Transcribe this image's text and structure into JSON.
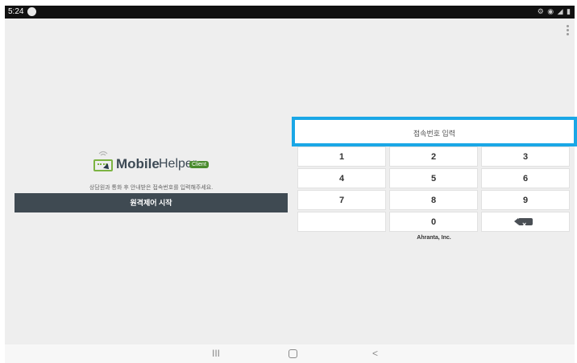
{
  "status_bar": {
    "time": "5:24",
    "icons": "⚙ ◉ ◢ ▮"
  },
  "app": {
    "logo_mobile": "Mobile",
    "logo_helper": "Helper",
    "logo_client_badge": "Client",
    "instruction": "상담원과 통화 후 안내받은 접속번호를 입력해주세요.",
    "start_button": "원격제어 시작",
    "code_input_placeholder": "접속번호 입력",
    "keys": [
      "1",
      "2",
      "3",
      "4",
      "5",
      "6",
      "7",
      "8",
      "9",
      "",
      "0"
    ],
    "company": "Ahranta, Inc."
  },
  "colors": {
    "accent": "#1aa7e6",
    "button_bg": "#3f4a52",
    "logo_green": "#7cb342"
  },
  "icons": {
    "backspace": "backspace-icon",
    "overflow": "more-vertical-icon",
    "notification": "notification-dot-icon"
  },
  "navigation": {
    "recents": "III",
    "home": "",
    "back": "<"
  }
}
